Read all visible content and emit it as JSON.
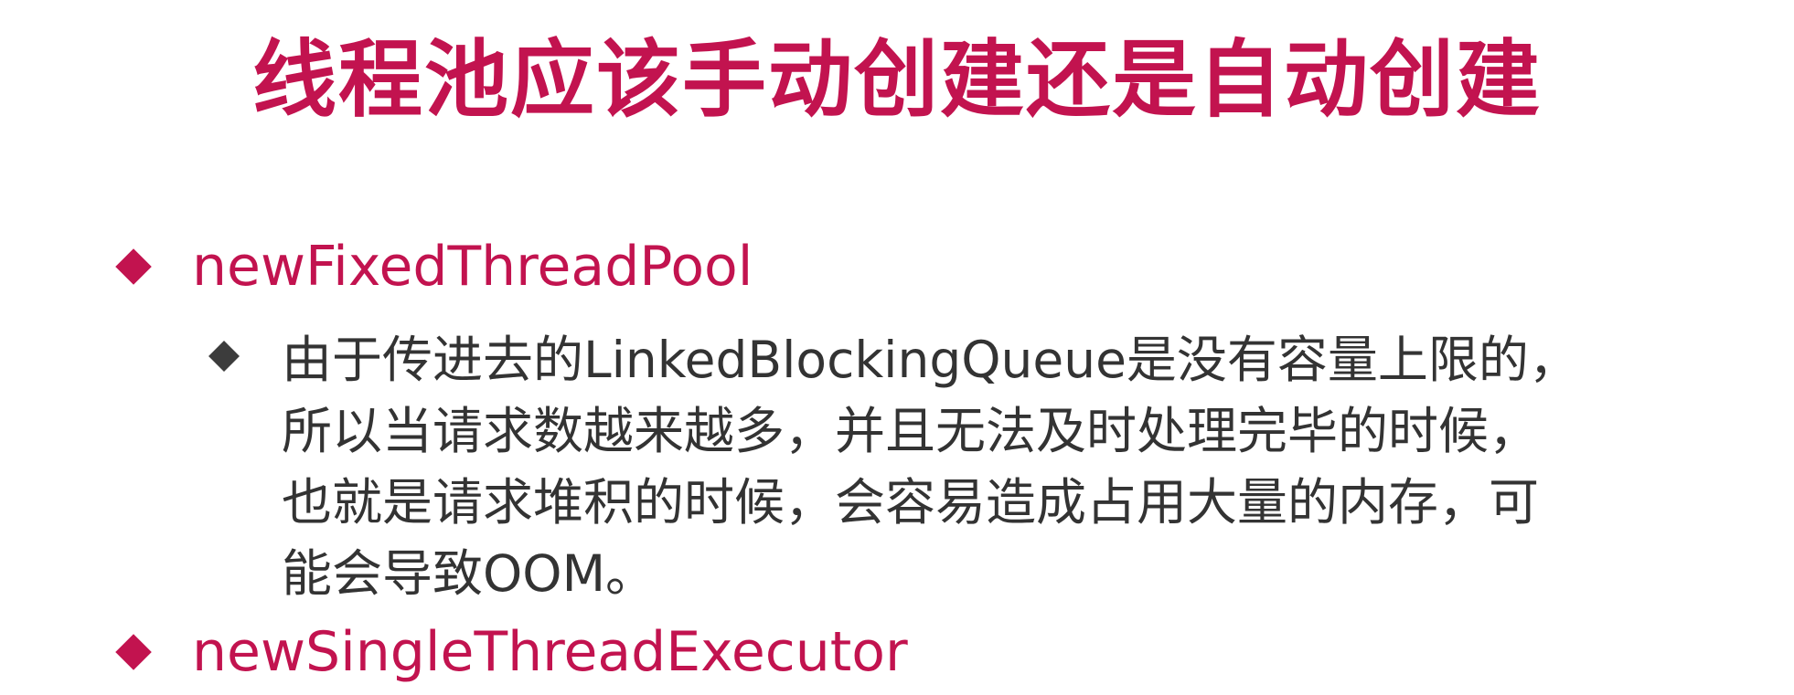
{
  "slide": {
    "title": "线程池应该手动创建还是自动创建",
    "bullets": [
      {
        "label": "newFixedThreadPool",
        "sub_bullets": [
          {
            "lines": [
              "由于传进去的LinkedBlockingQueue是没有容量上限的，",
              "所以当请求数越来越多，并且无法及时处理完毕的时候，",
              "也就是请求堆积的时候，会容易造成占用大量的内存，可",
              "能会导致OOM。"
            ]
          }
        ]
      },
      {
        "label": "newSingleThreadExecutor"
      }
    ]
  },
  "colors": {
    "accent": "#c2134f",
    "body_text": "#333333",
    "sub_bullet_marker": "#3c3c3c",
    "background": "#ffffff"
  },
  "icons": {
    "bullet_marker": "diamond-icon",
    "sub_bullet_marker": "diamond-icon"
  }
}
